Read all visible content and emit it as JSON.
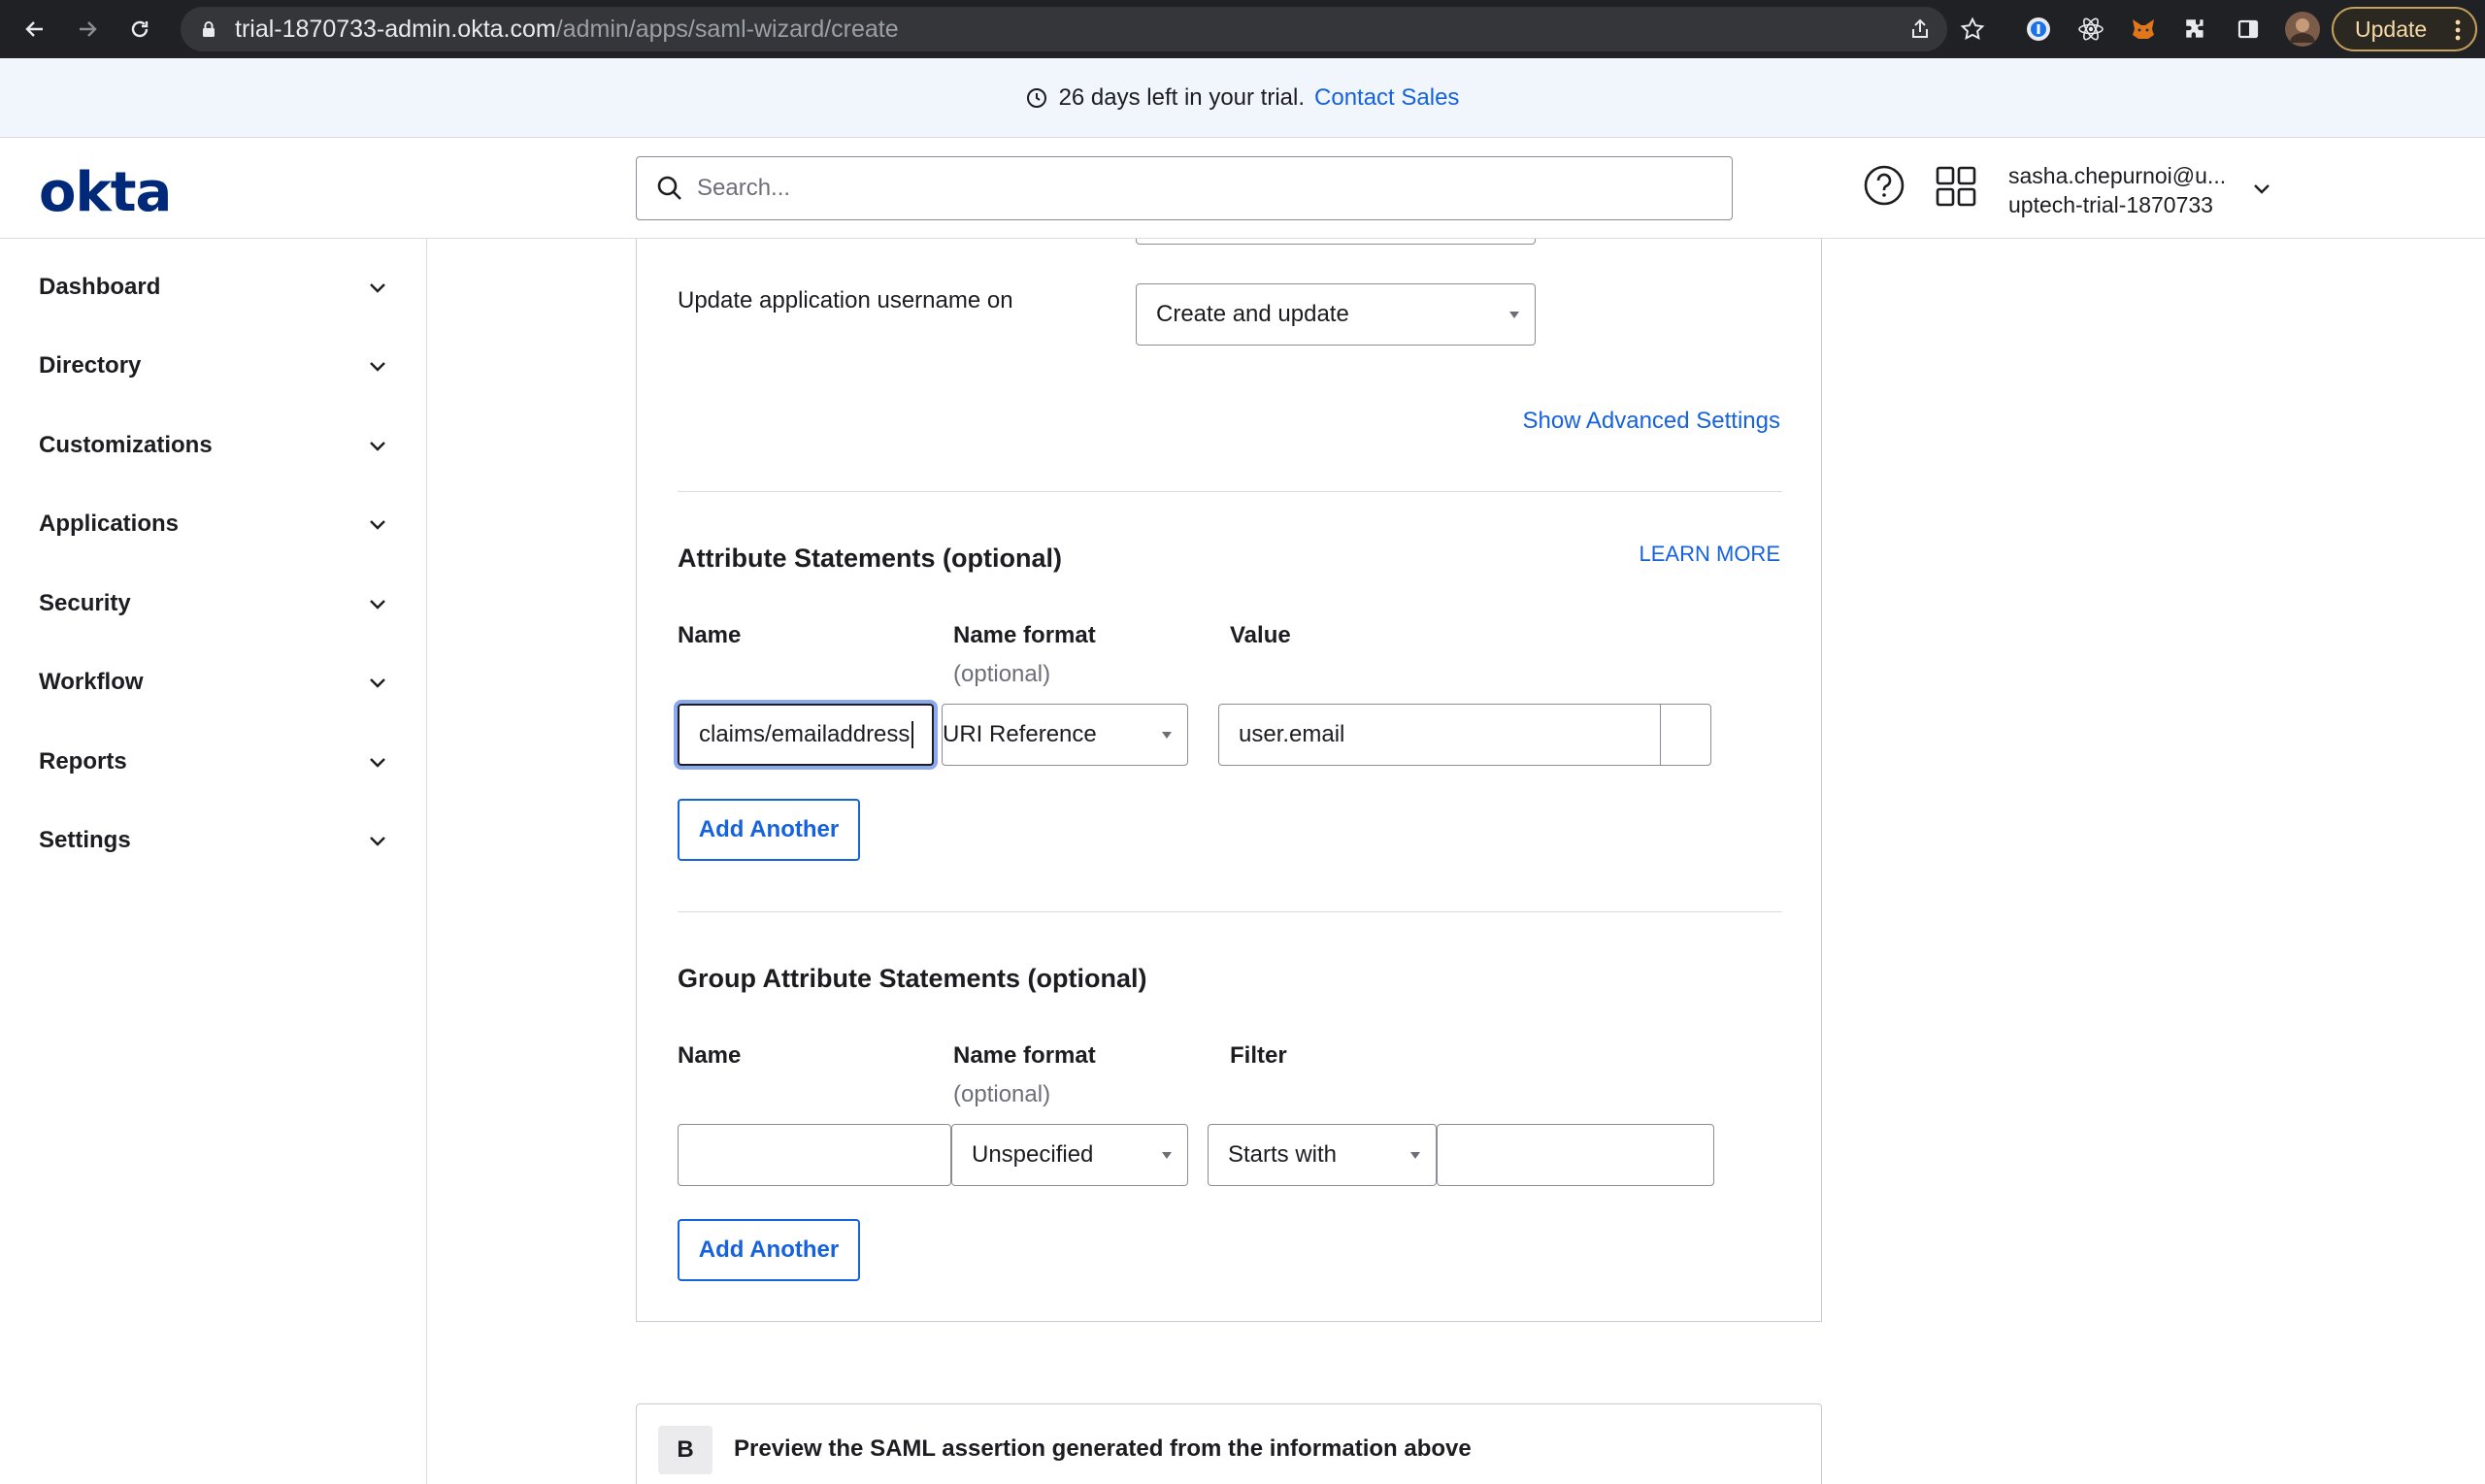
{
  "browser": {
    "url_host": "trial-1870733-admin.okta.com",
    "url_path": "/admin/apps/saml-wizard/create",
    "update_label": "Update"
  },
  "banner": {
    "text": "26 days left in your trial.",
    "link": "Contact Sales"
  },
  "header": {
    "logo": "okta",
    "search_placeholder": "Search...",
    "user_email": "sasha.chepurnoi@u...",
    "user_org": "uptech-trial-1870733"
  },
  "sidebar": {
    "items": [
      {
        "label": "Dashboard"
      },
      {
        "label": "Directory"
      },
      {
        "label": "Customizations"
      },
      {
        "label": "Applications"
      },
      {
        "label": "Security"
      },
      {
        "label": "Workflow"
      },
      {
        "label": "Reports"
      },
      {
        "label": "Settings"
      }
    ]
  },
  "form": {
    "update_username_label": "Update application username on",
    "update_username_value": "Create and update",
    "show_advanced": "Show Advanced Settings",
    "attr": {
      "title": "Attribute Statements (optional)",
      "learn_more": "LEARN MORE",
      "col_name": "Name",
      "col_format": "Name format",
      "col_format_sub": "(optional)",
      "col_value": "Value",
      "row_name": "claims/emailaddress",
      "row_format": "URI Reference",
      "row_value": "user.email",
      "add_another": "Add Another"
    },
    "group": {
      "title": "Group Attribute Statements (optional)",
      "col_name": "Name",
      "col_format": "Name format",
      "col_format_sub": "(optional)",
      "col_filter": "Filter",
      "row_format": "Unspecified",
      "row_filter": "Starts with",
      "add_another": "Add Another"
    }
  },
  "section_b": {
    "badge": "B",
    "title": "Preview the SAML assertion generated from the information above"
  },
  "colors": {
    "brand": "#00297a",
    "link": "#1662dd",
    "banner_bg": "#f1f5fc"
  }
}
